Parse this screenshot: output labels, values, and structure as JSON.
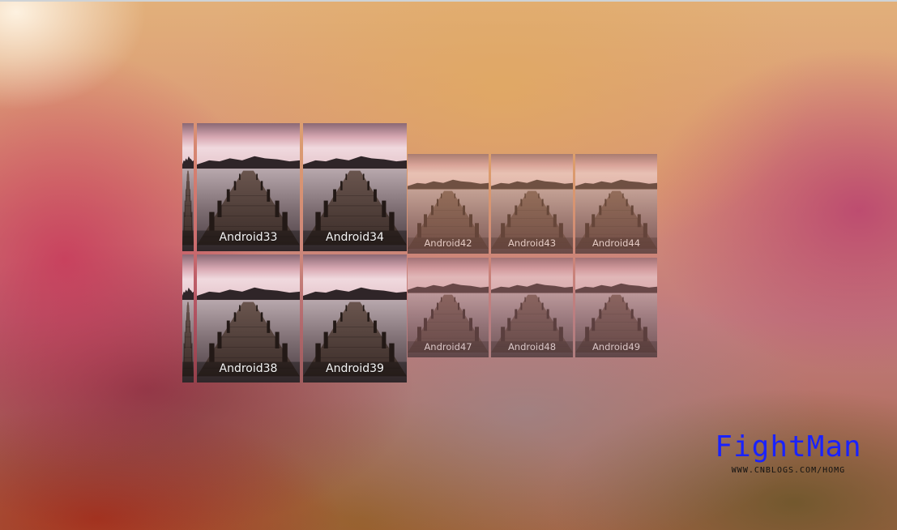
{
  "gallery": {
    "tiles": [
      {
        "label": "Android33"
      },
      {
        "label": "Android34"
      },
      {
        "label": "Android42"
      },
      {
        "label": "Android43"
      },
      {
        "label": "Android44"
      },
      {
        "label": "Android38"
      },
      {
        "label": "Android39"
      },
      {
        "label": "Android47"
      },
      {
        "label": "Android48"
      },
      {
        "label": "Android49"
      }
    ]
  },
  "watermark": {
    "title": "FightMan",
    "url": "WWW.CNBLOGS.COM/HOMG",
    "title_color": "#1a22ff"
  },
  "image_subject": "pier-photo-thumbnail"
}
